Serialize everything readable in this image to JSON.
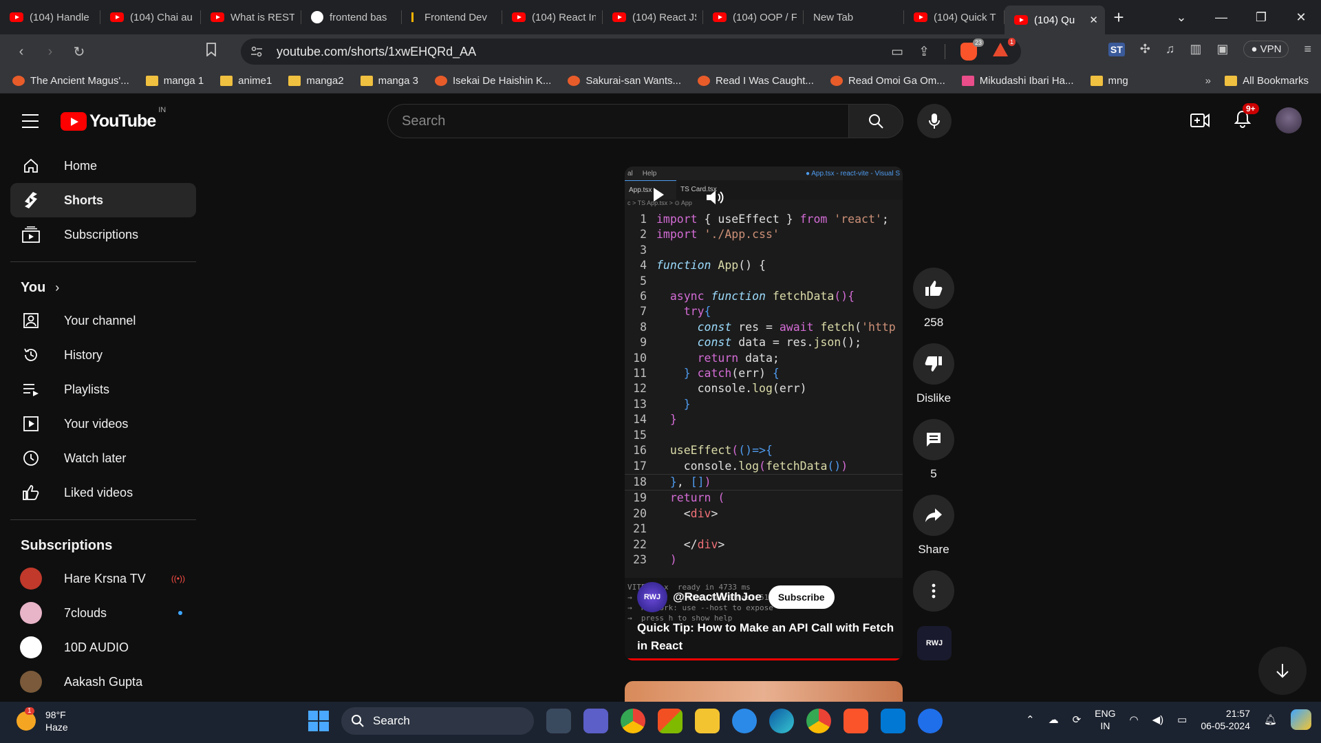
{
  "browser": {
    "tabs": [
      {
        "label": "(104) Handle",
        "icon": "youtube-icon"
      },
      {
        "label": "(104) Chai au",
        "icon": "youtube-icon"
      },
      {
        "label": "What is REST",
        "icon": "youtube-icon"
      },
      {
        "label": "frontend bas",
        "icon": "google-icon"
      },
      {
        "label": "Frontend Dev",
        "icon": "bookmark-icon"
      },
      {
        "label": "(104) React In",
        "icon": "youtube-icon"
      },
      {
        "label": "(104) React JS",
        "icon": "youtube-icon"
      },
      {
        "label": "(104) OOP / F",
        "icon": "youtube-icon"
      },
      {
        "label": "New Tab",
        "icon": ""
      },
      {
        "label": "(104) Quick T",
        "icon": "youtube-icon"
      },
      {
        "label": "(104) Qu",
        "icon": "youtube-icon"
      }
    ],
    "url": "youtube.com/shorts/1xwEHQRd_AA",
    "brave_badge": "23",
    "rewards_badge": "1",
    "vpn_label": "VPN",
    "bookmarks": [
      {
        "label": "The Ancient Magus'...",
        "icon": "site"
      },
      {
        "label": "manga 1",
        "icon": "folder"
      },
      {
        "label": "anime1",
        "icon": "folder"
      },
      {
        "label": "manga2",
        "icon": "folder"
      },
      {
        "label": "manga 3",
        "icon": "folder"
      },
      {
        "label": "Isekai De Haishin K...",
        "icon": "site"
      },
      {
        "label": "Sakurai-san Wants...",
        "icon": "site"
      },
      {
        "label": "Read I Was Caught...",
        "icon": "site"
      },
      {
        "label": "Read Omoi Ga Om...",
        "icon": "site"
      },
      {
        "label": "Mikudashi Ibari Ha...",
        "icon": "manga"
      },
      {
        "label": "mng",
        "icon": "folder"
      }
    ],
    "bookmarks_more": "»",
    "all_bookmarks": "All Bookmarks"
  },
  "youtube": {
    "logo_text": "YouTube",
    "country_code": "IN",
    "search_placeholder": "Search",
    "notifications_badge": "9+",
    "sidebar": {
      "main": [
        {
          "label": "Home",
          "icon": "home-icon"
        },
        {
          "label": "Shorts",
          "icon": "shorts-icon"
        },
        {
          "label": "Subscriptions",
          "icon": "subscriptions-icon"
        }
      ],
      "you_label": "You",
      "you_items": [
        {
          "label": "Your channel",
          "icon": "your-channel-icon"
        },
        {
          "label": "History",
          "icon": "history-icon"
        },
        {
          "label": "Playlists",
          "icon": "playlists-icon"
        },
        {
          "label": "Your videos",
          "icon": "your-videos-icon"
        },
        {
          "label": "Watch later",
          "icon": "watch-later-icon"
        },
        {
          "label": "Liked videos",
          "icon": "liked-videos-icon"
        }
      ],
      "subscriptions_label": "Subscriptions",
      "subscriptions": [
        {
          "label": "Hare Krsna TV",
          "status": "live",
          "color": "#c0392b"
        },
        {
          "label": "7clouds",
          "status": "new",
          "color": "#e8b4c8"
        },
        {
          "label": "10D AUDIO",
          "status": "",
          "color": "#ffffff"
        },
        {
          "label": "Aakash Gupta",
          "status": "",
          "color": "#7a5a3a"
        }
      ]
    },
    "short": {
      "vscode_menu": [
        "al",
        "Help"
      ],
      "vscode_title": "● App.tsx - react-vite - Visual S",
      "vscode_tabs": [
        "App.tsx",
        "TS Card.tsx"
      ],
      "breadcrumb": "c > TS App.tsx > ⊙ App",
      "code_lines": [
        "1",
        "2",
        "3",
        "4",
        "5",
        "6",
        "7",
        "8",
        "9",
        "10",
        "11",
        "12",
        "13",
        "14",
        "15",
        "16",
        "17",
        "18",
        "19",
        "20",
        "21",
        "22",
        "23"
      ],
      "terminal": [
        "VITE v5.x  ready in 4733 ms",
        "→  Local:   http://localhost:5173/",
        "→  Network: use --host to expose",
        "→  press h to show help"
      ],
      "channel": "@ReactWithJoe",
      "channel_avatar_text": "RWJ",
      "subscribe_label": "Subscribe",
      "title": "Quick Tip: How to Make an API Call with Fetch in React",
      "progress": 1.0
    },
    "actions": {
      "like_count": "258",
      "dislike_label": "Dislike",
      "comment_count": "5",
      "share_label": "Share"
    }
  },
  "taskbar": {
    "weather_temp": "98°F",
    "weather_desc": "Haze",
    "weather_badge": "1",
    "search_label": "Search",
    "lang_line1": "ENG",
    "lang_line2": "IN",
    "time": "21:57",
    "date": "06-05-2024"
  }
}
